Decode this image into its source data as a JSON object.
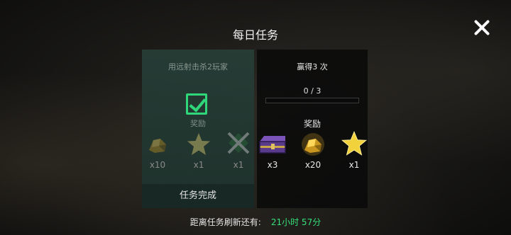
{
  "title": "每日任务",
  "completed_task": {
    "description": "用远射击杀2玩家",
    "reward_label": "奖励",
    "rewards": [
      {
        "icon": "gold-ore-icon",
        "qty": "x10"
      },
      {
        "icon": "star-icon",
        "qty": "x1"
      },
      {
        "icon": "crossed-rifles-icon",
        "qty": "x1"
      }
    ],
    "status": "任务完成"
  },
  "active_task": {
    "goal": "赢得3 次",
    "progress_text": "0 / 3",
    "progress_fraction": 0,
    "reward_label": "奖励",
    "rewards": [
      {
        "icon": "purple-chest-icon",
        "qty": "x3"
      },
      {
        "icon": "gold-ore-icon",
        "qty": "x20"
      },
      {
        "icon": "star-icon",
        "qty": "x1"
      }
    ]
  },
  "footer": {
    "refresh_label": "距离任务刷新还有:",
    "refresh_time": "21小时 57分"
  },
  "colors": {
    "check": "#2fd77a",
    "timer": "#35e07a",
    "star": "#f2d23c",
    "gold": "#d9a62b"
  }
}
